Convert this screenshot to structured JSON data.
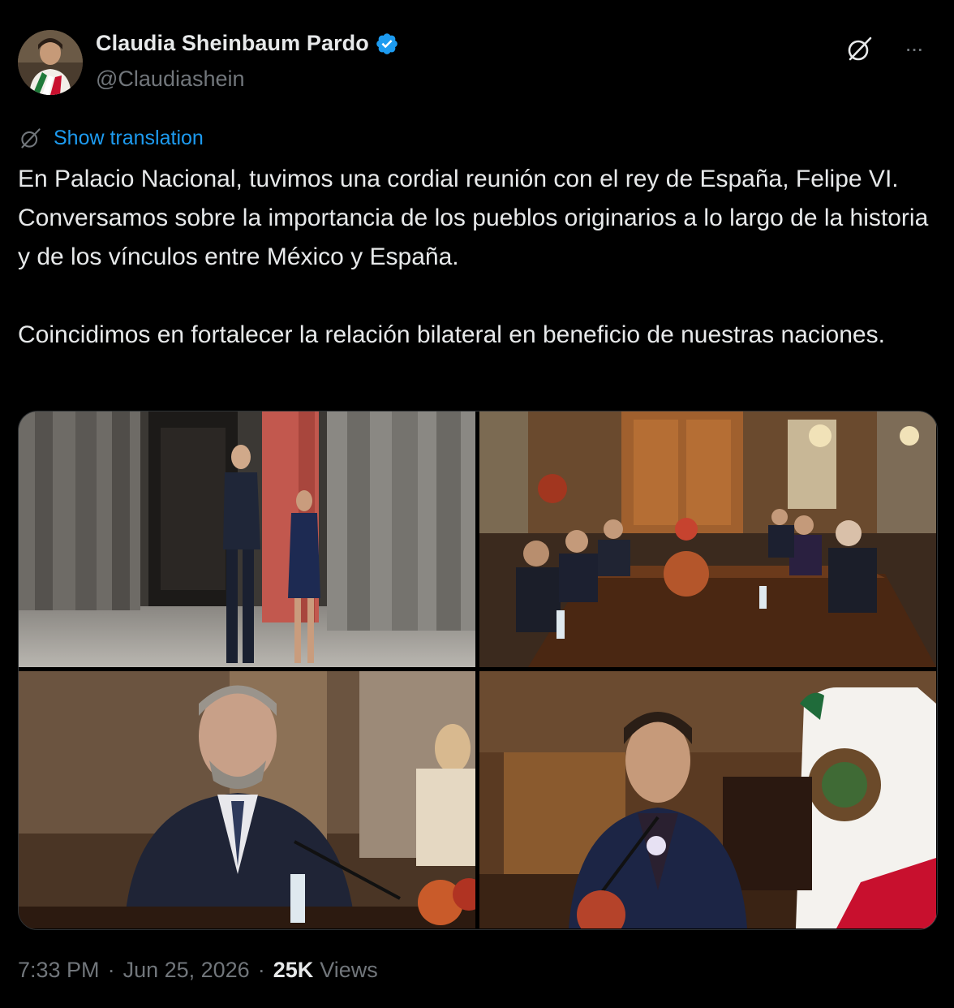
{
  "author": {
    "display_name": "Claudia Sheinbaum Pardo",
    "handle": "@Claudiashein",
    "verified": true
  },
  "header_icons": [
    "grok-icon",
    "more-options-icon"
  ],
  "header_more_label": "···",
  "translation": {
    "label": "Show translation",
    "icon": "translate-icon"
  },
  "tweet": {
    "paragraph_1": "En Palacio Nacional, tuvimos una cordial reunión con el rey de España, Felipe VI. Conversamos sobre la importancia de los pueblos originarios a lo largo de la historia y de los vínculos entre México y España.",
    "paragraph_2": "Coincidimos en fortalecer la relación bilateral en beneficio de nuestras naciones."
  },
  "media": [
    {
      "name": "photo-palace-corridor",
      "kind": "photo"
    },
    {
      "name": "photo-meeting-table",
      "kind": "photo"
    },
    {
      "name": "photo-king-speaking",
      "kind": "photo"
    },
    {
      "name": "photo-president-speaking",
      "kind": "photo"
    }
  ],
  "meta": {
    "time": "7:33 PM",
    "date": "Jun 25, 2026",
    "separator": "·",
    "views_count": "25K",
    "views_label": "Views"
  },
  "colors": {
    "background": "#000000",
    "text_primary": "#e7e9ea",
    "text_secondary": "#71767b",
    "link": "#1d9bf0",
    "border": "#2f3336"
  }
}
